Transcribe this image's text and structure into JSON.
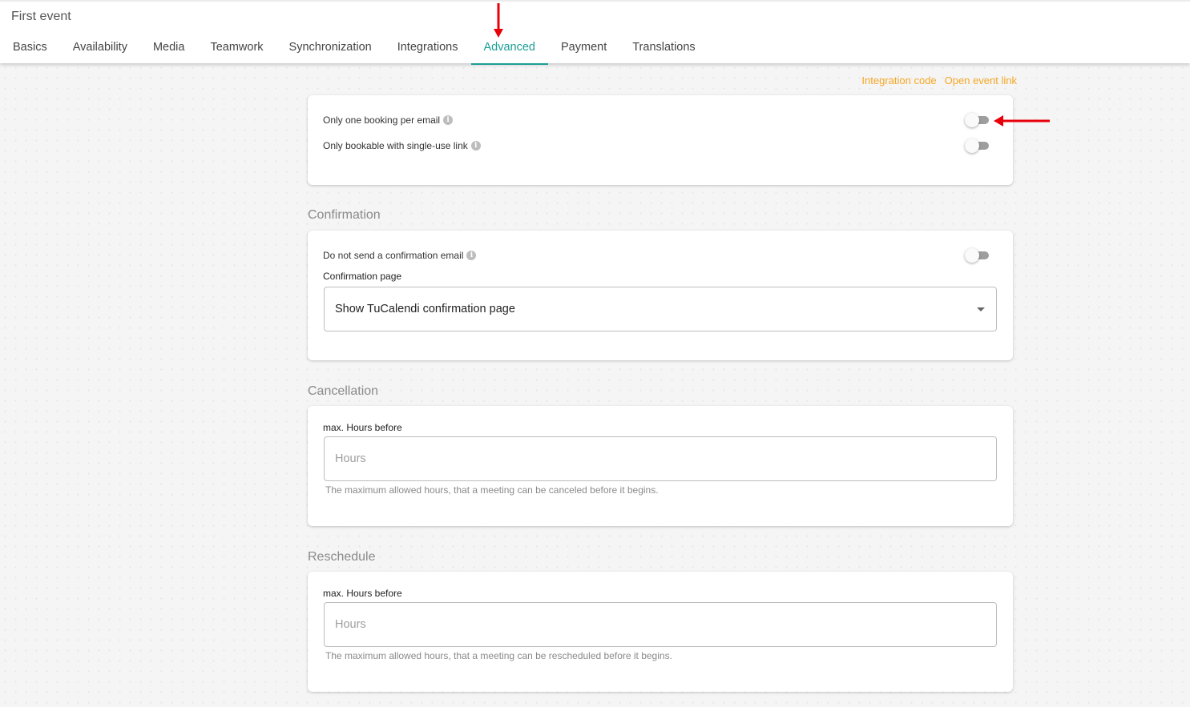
{
  "header": {
    "title": "First event",
    "tabs": [
      {
        "label": "Basics",
        "active": false
      },
      {
        "label": "Availability",
        "active": false
      },
      {
        "label": "Media",
        "active": false
      },
      {
        "label": "Teamwork",
        "active": false
      },
      {
        "label": "Synchronization",
        "active": false
      },
      {
        "label": "Integrations",
        "active": false
      },
      {
        "label": "Advanced",
        "active": true
      },
      {
        "label": "Payment",
        "active": false
      },
      {
        "label": "Translations",
        "active": false
      }
    ]
  },
  "links": {
    "integration_code": "Integration code",
    "open_event_link": "Open event link"
  },
  "booking": {
    "one_per_email": {
      "label": "Only one booking per email",
      "enabled": false
    },
    "single_use_link": {
      "label": "Only bookable with single-use link",
      "enabled": false
    }
  },
  "confirmation": {
    "title": "Confirmation",
    "no_email": {
      "label": "Do not send a confirmation email",
      "enabled": false
    },
    "page_label": "Confirmation page",
    "page_value": "Show TuCalendi confirmation page"
  },
  "cancellation": {
    "title": "Cancellation",
    "field_label": "max. Hours before",
    "placeholder": "Hours",
    "value": "",
    "hint": "The maximum allowed hours, that a meeting can be canceled before it begins."
  },
  "reschedule": {
    "title": "Reschedule",
    "field_label": "max. Hours before",
    "placeholder": "Hours",
    "value": "",
    "hint": "The maximum allowed hours, that a meeting can be rescheduled before it begins."
  },
  "colors": {
    "accent": "#1a9e95",
    "link": "#f5a623",
    "annotation": "#e8000b"
  }
}
